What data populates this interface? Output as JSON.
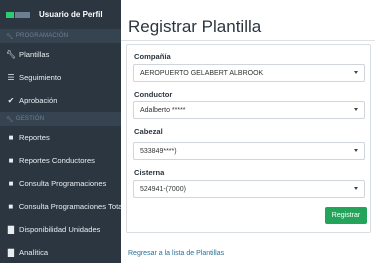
{
  "sidebar": {
    "user_name": "Usuario de Perfil",
    "sections": [
      {
        "label": "PROGRAMACIÓN",
        "icon": "wrench-icon"
      },
      {
        "label": "GESTIÓN",
        "icon": "wrench-icon"
      }
    ],
    "items": [
      {
        "label": "Plantillas",
        "icon": "wrench-icon"
      },
      {
        "label": "Seguimiento",
        "icon": "list-icon"
      },
      {
        "label": "Aprobación",
        "icon": "check-icon"
      },
      {
        "label": "Reportes",
        "icon": "folder-icon"
      },
      {
        "label": "Reportes Conductores",
        "icon": "folder-icon"
      },
      {
        "label": "Consulta Programaciones",
        "icon": "folder-icon"
      },
      {
        "label": "Consulta Programaciones Total",
        "icon": "folder-icon"
      },
      {
        "label": "Disponibilidad Unidades",
        "icon": "bar-chart-icon"
      },
      {
        "label": "Analítica",
        "icon": "bar-chart-icon"
      }
    ]
  },
  "main": {
    "title": "Registrar Plantilla",
    "fields": [
      {
        "label": "Compañía",
        "value": "AEROPUERTO GELABERT ALBROOK"
      },
      {
        "label": "Conductor",
        "value": "Adalberto *****"
      },
      {
        "label": "Cabezal",
        "value": "533849****)"
      },
      {
        "label": "Cisterna",
        "value": "524941-(7000)"
      }
    ],
    "submit_label": "Registrar",
    "back_link": "Regresar a la lista de Plantillas"
  },
  "colors": {
    "sidebar_bg": "#2b3640",
    "accent_green": "#24a35a",
    "link": "#2a6f97"
  }
}
